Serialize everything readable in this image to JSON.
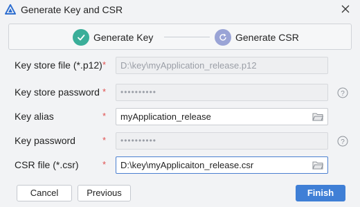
{
  "window": {
    "title": "Generate Key and CSR",
    "icon": "deveco-logo-icon",
    "close_icon": "close-icon"
  },
  "stepper": {
    "steps": [
      {
        "label": "Generate Key",
        "state": "completed",
        "icon": "check-icon",
        "color": "#3aae99"
      },
      {
        "label": "Generate CSR",
        "state": "current",
        "icon": "refresh-icon",
        "color": "#9aa4d6"
      }
    ]
  },
  "form": {
    "key_store_file": {
      "label": "Key store file (*.p12)",
      "required_mark": "*",
      "value": "D:\\key\\myApplication_release.p12",
      "enabled": false
    },
    "key_store_password": {
      "label": "Key store password",
      "required_mark": "*",
      "value": "••••••••••",
      "enabled": false,
      "help_icon": "help-icon"
    },
    "key_alias": {
      "label": "Key alias",
      "required_mark": "*",
      "value": "myApplication_release",
      "enabled": true,
      "button_icon": "folder-icon"
    },
    "key_password": {
      "label": "Key password",
      "required_mark": "*",
      "value": "••••••••••",
      "enabled": false,
      "help_icon": "help-icon"
    },
    "csr_file": {
      "label": "CSR file (*.csr)",
      "required_mark": "*",
      "value": "D:\\key\\myApplicaiton_release.csr",
      "enabled": true,
      "focused": true,
      "button_icon": "folder-icon"
    }
  },
  "buttons": {
    "cancel": "Cancel",
    "previous": "Previous",
    "finish": "Finish"
  },
  "colors": {
    "primary": "#3f7fd6",
    "required": "#e05050",
    "step_done": "#3aae99",
    "step_current": "#9aa4d6"
  }
}
